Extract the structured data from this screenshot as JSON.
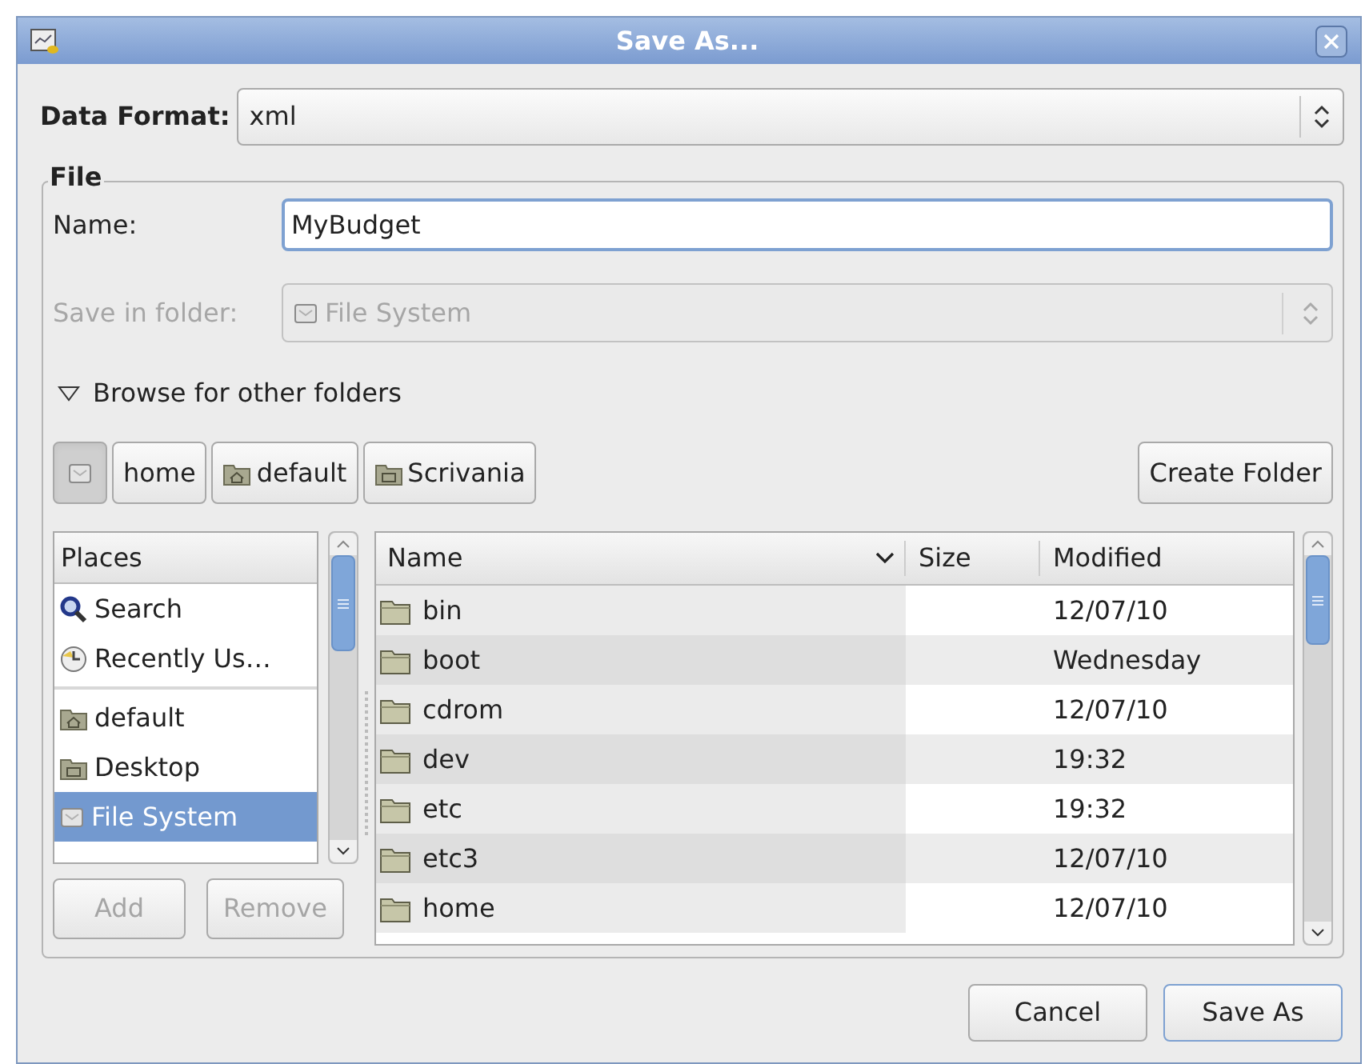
{
  "window": {
    "title": "Save As..."
  },
  "data_format": {
    "label": "Data Format:",
    "value": "xml"
  },
  "file_group": {
    "title": "File",
    "name": {
      "label": "Name:",
      "value": "MyBudget"
    },
    "save_in_folder": {
      "label": "Save in folder:",
      "value": "File System",
      "disabled": true
    },
    "browse": {
      "label": "Browse for other folders",
      "expanded": true
    },
    "path_bar": [
      {
        "kind": "drive",
        "selected": true
      },
      {
        "kind": "plain",
        "label": "home",
        "selected": false
      },
      {
        "kind": "home",
        "label": "default",
        "selected": false
      },
      {
        "kind": "desktop",
        "label": "Scrivania",
        "selected": false
      }
    ],
    "create_folder": "Create Folder",
    "places": {
      "header": "Places",
      "groups": [
        [
          {
            "kind": "search",
            "label": "Search",
            "selected": false
          },
          {
            "kind": "recent",
            "label": "Recently Us…",
            "selected": false
          }
        ],
        [
          {
            "kind": "home",
            "label": "default",
            "selected": false
          },
          {
            "kind": "desktop",
            "label": "Desktop",
            "selected": false
          },
          {
            "kind": "drive",
            "label": "File System",
            "selected": true
          }
        ]
      ]
    },
    "add": {
      "label": "Add",
      "disabled": true
    },
    "remove": {
      "label": "Remove",
      "disabled": true
    },
    "files": {
      "columns": [
        "Name",
        "Size",
        "Modified"
      ],
      "rows": [
        {
          "name": "bin",
          "modified": "12/07/10"
        },
        {
          "name": "boot",
          "modified": "Wednesday"
        },
        {
          "name": "cdrom",
          "modified": "12/07/10"
        },
        {
          "name": "dev",
          "modified": "19:32"
        },
        {
          "name": "etc",
          "modified": "19:32"
        },
        {
          "name": "etc3",
          "modified": "12/07/10"
        },
        {
          "name": "home",
          "modified": "12/07/10"
        }
      ]
    }
  },
  "buttons": [
    {
      "label": "Cancel",
      "default": false
    },
    {
      "label": "Save As",
      "default": true
    }
  ]
}
